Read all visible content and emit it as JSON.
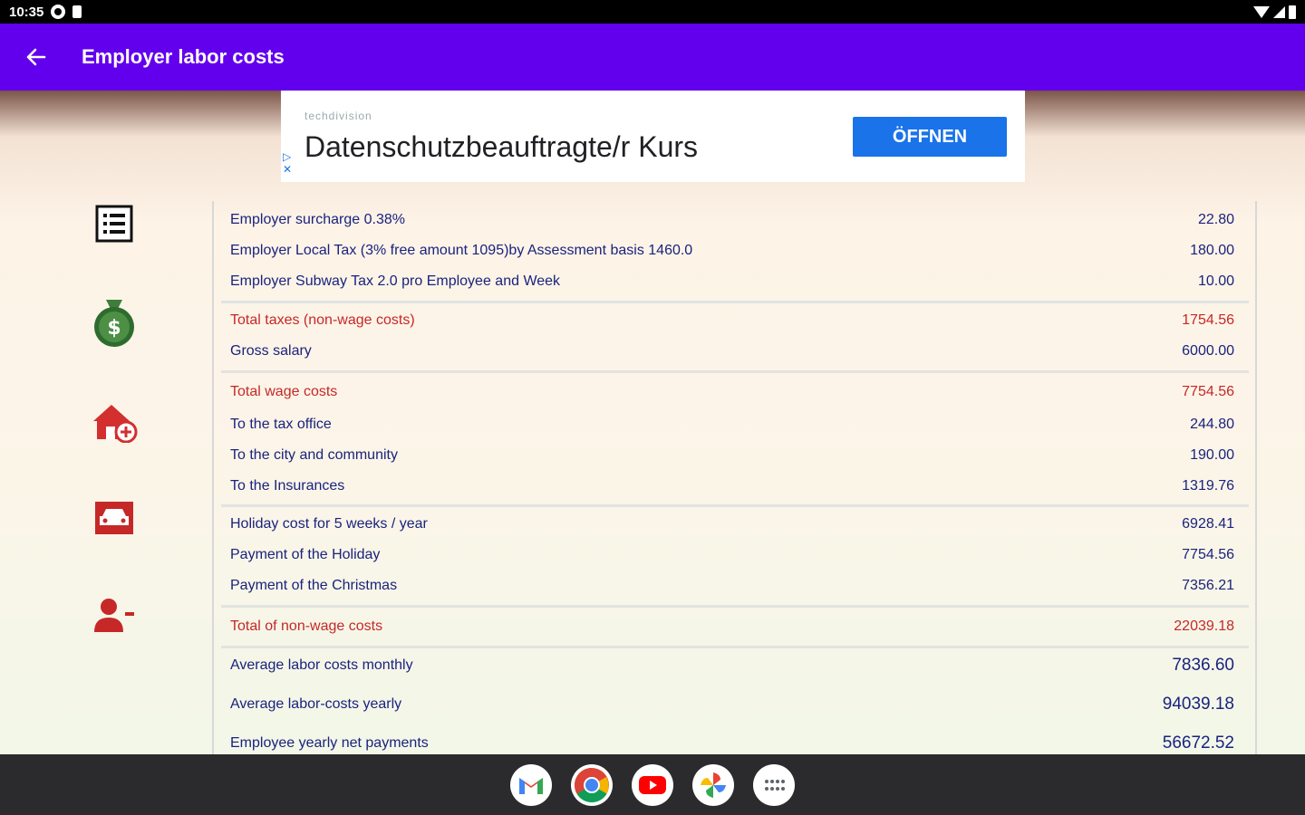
{
  "status": {
    "time": "10:35"
  },
  "app_bar": {
    "title": "Employer labor costs"
  },
  "ad": {
    "sponsor": "techdivision",
    "headline": "Datenschutzbeauftragte/r Kurs",
    "button": "ÖFFNEN"
  },
  "rows": [
    {
      "label": "Employer surcharge 0.38%",
      "value": "22.80"
    },
    {
      "label": "Employer Local Tax (3% free amount 1095)by Assessment basis 1460.0",
      "value": "180.00"
    },
    {
      "label": "Employer Subway Tax 2.0 pro Employee and Week",
      "value": "10.00"
    },
    {
      "label": "Total taxes (non-wage costs)",
      "value": "1754.56"
    },
    {
      "label": "Gross salary",
      "value": "6000.00"
    },
    {
      "label": "Total wage costs",
      "value": "7754.56"
    },
    {
      "label": "To the tax office",
      "value": "244.80"
    },
    {
      "label": "To the city and community",
      "value": "190.00"
    },
    {
      "label": "To the Insurances",
      "value": "1319.76"
    },
    {
      "label": "Holiday cost for 5 weeks / year",
      "value": "6928.41"
    },
    {
      "label": "Payment of the Holiday",
      "value": "7754.56"
    },
    {
      "label": "Payment of the Christmas",
      "value": "7356.21"
    },
    {
      "label": "Total of non-wage costs",
      "value": "22039.18"
    },
    {
      "label": "Average labor costs monthly",
      "value": "7836.60"
    },
    {
      "label": "Average labor-costs yearly",
      "value": "94039.18"
    },
    {
      "label": "Employee yearly net payments",
      "value": "56672.52"
    }
  ],
  "colors": {
    "accent": "#6200ee",
    "highlight": "#c62828",
    "text": "#1a237e"
  },
  "side_icons": [
    "list-icon",
    "money-bag-icon",
    "house-add-icon",
    "car-icon",
    "person-remove-icon"
  ],
  "dock": [
    "gmail-icon",
    "chrome-icon",
    "youtube-icon",
    "photos-icon",
    "apps-icon"
  ]
}
